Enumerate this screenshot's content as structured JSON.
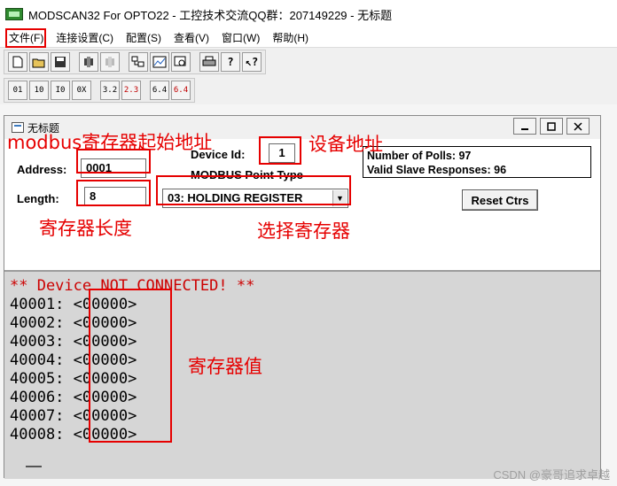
{
  "window": {
    "title": "MODSCAN32 For OPTO22 - 工控技术交流QQ群：207149229 - 无标题"
  },
  "menu": {
    "items": [
      "文件(F)",
      "连接设置(C)",
      "配置(S)",
      "查看(V)",
      "窗口(W)",
      "帮助(H)"
    ]
  },
  "toolbar1": {
    "buttons": [
      "new-icon",
      "open-icon",
      "save-icon",
      "connect-icon",
      "disconnect-icon",
      "display-icon",
      "graph-icon",
      "zoom-icon",
      "print-icon",
      "help-icon",
      "context-help-icon"
    ]
  },
  "toolbar2": {
    "buttons": [
      {
        "name": "coil-01-icon",
        "text": "01"
      },
      {
        "name": "input-10-icon",
        "text": "10"
      },
      {
        "name": "input-reg-icon",
        "text": "I0"
      },
      {
        "name": "hex-icon",
        "text": "0X"
      },
      {
        "name": "fmt-32-icon",
        "text": "3.2"
      },
      {
        "name": "fmt-swap-icon",
        "text": "2.3"
      },
      {
        "name": "fmt-64-icon",
        "text": "6.4"
      },
      {
        "name": "fmt-64b-icon",
        "text": "6.4"
      }
    ]
  },
  "doc": {
    "title": "无标题",
    "address_label": "Address:",
    "address_value": "0001",
    "length_label": "Length:",
    "length_value": "8",
    "device_id_label": "Device Id:",
    "device_id_value": "1",
    "point_type_label": "MODBUS Point Type",
    "point_type_value": "03: HOLDING REGISTER",
    "polls_text": "Number of Polls: 97",
    "responses_text": "Valid Slave Responses: 96",
    "reset_label": "Reset Ctrs"
  },
  "data": {
    "status": "** Device NOT CONNECTED! **",
    "registers": [
      {
        "addr": "40001:",
        "value": "<00000>"
      },
      {
        "addr": "40002:",
        "value": "<00000>"
      },
      {
        "addr": "40003:",
        "value": "<00000>"
      },
      {
        "addr": "40004:",
        "value": "<00000>"
      },
      {
        "addr": "40005:",
        "value": "<00000>"
      },
      {
        "addr": "40006:",
        "value": "<00000>"
      },
      {
        "addr": "40007:",
        "value": "<00000>"
      },
      {
        "addr": "40008:",
        "value": "<00000>"
      }
    ]
  },
  "annotations": {
    "start_address": "modbus寄存器起始地址",
    "device_address": "设备地址",
    "register_length": "寄存器长度",
    "select_register": "选择寄存器",
    "register_value": "寄存器值"
  },
  "watermark": "CSDN @豪哥追求卓越",
  "colors": {
    "annotation": "#e60000",
    "status_text": "#cc0000"
  }
}
